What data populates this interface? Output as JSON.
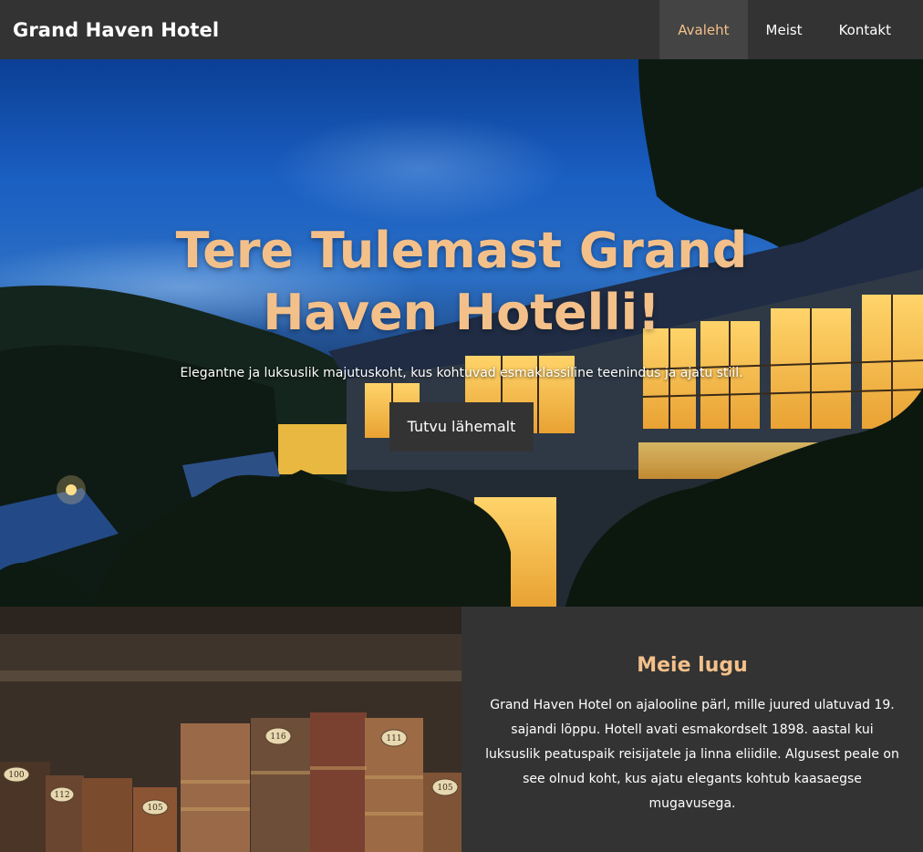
{
  "nav": {
    "brand": "Grand Haven Hotel",
    "items": [
      {
        "label": "Avaleht",
        "active": true
      },
      {
        "label": "Meist",
        "active": false
      },
      {
        "label": "Kontakt",
        "active": false
      }
    ]
  },
  "hero": {
    "title": "Tere Tulemast Grand Haven Hotelli!",
    "subtitle": "Elegantne ja luksuslik majutuskoht, kus kohtuvad esmaklassiline teenindus ja ajatu stiil.",
    "button": "Tutvu lähemalt"
  },
  "story": {
    "title": "Meie lugu",
    "body": "Grand Haven Hotel on ajalooline pärl, mille juured ulatuvad 19. sajandi lõppu. Hotell avati esmakordselt 1898. aastal kui luksuslik peatuspaik reisijatele ja linna eliidile. Algusest peale on see olnud koht, kus ajatu elegants kohtub kaasaegse mugavusega.",
    "book_labels": [
      "100",
      "112",
      "105",
      "116",
      "111",
      "105"
    ]
  },
  "colors": {
    "accent": "#f4c08a",
    "dark": "#333333",
    "active_nav": "#444444"
  }
}
